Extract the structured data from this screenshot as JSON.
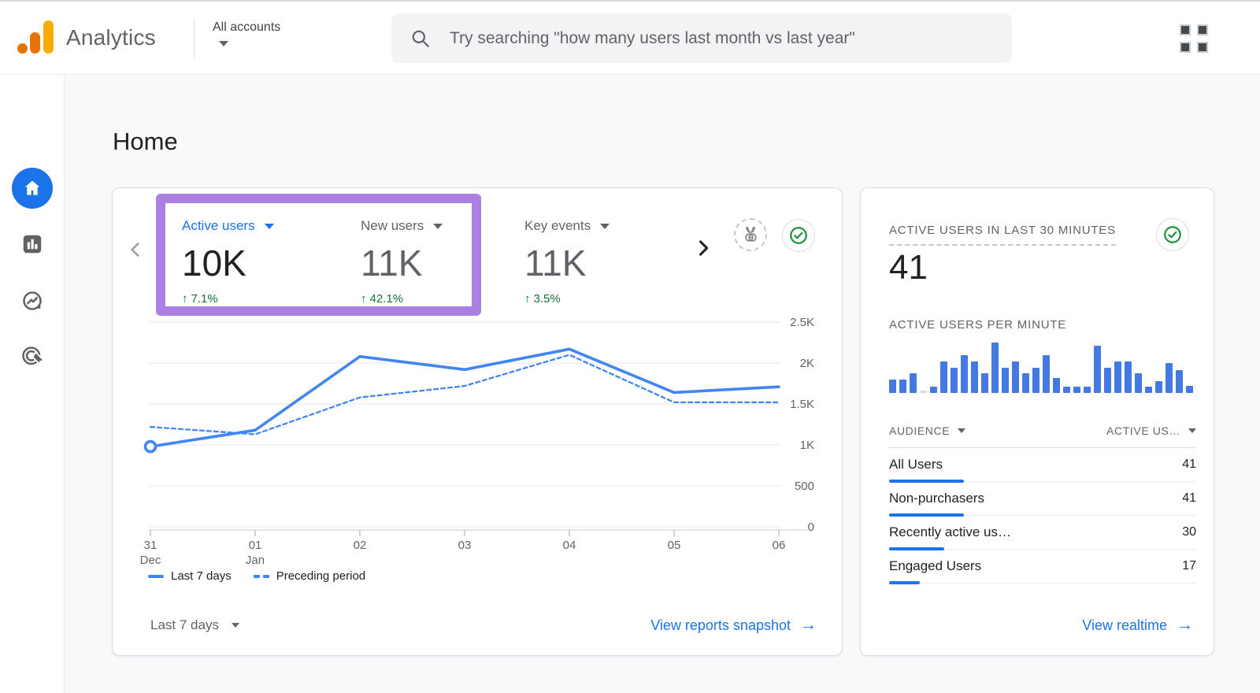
{
  "colors": {
    "accent_blue": "#1a73e8",
    "chart_blue": "#4285f4",
    "bar_blue": "#4479e4",
    "positive_green": "#137333",
    "check_green": "#1e8e3e",
    "annotation_purple": "#aa80e2",
    "muted_gray": "#5f6368",
    "logo_amber": "#f9ab00",
    "logo_orange": "#e37400"
  },
  "icons": {
    "up_arrow": "↑",
    "forward_arrow": "→"
  },
  "topbar": {
    "brand": "Analytics",
    "account_label": "All accounts",
    "search_placeholder": "Try searching \"how many users last month vs last year\""
  },
  "sidebar": {
    "items": [
      {
        "name": "home",
        "active": true
      },
      {
        "name": "reports",
        "active": false
      },
      {
        "name": "explore",
        "active": false
      },
      {
        "name": "advertising",
        "active": false
      }
    ]
  },
  "page": {
    "title": "Home"
  },
  "overview_card": {
    "metrics": [
      {
        "label": "Active users",
        "value": "10K",
        "change": "7.1%",
        "selected": true
      },
      {
        "label": "New users",
        "value": "11K",
        "change": "42.1%",
        "selected": false
      },
      {
        "label": "Key events",
        "value": "11K",
        "change": "3.5%",
        "selected": false
      }
    ],
    "legend": [
      {
        "label": "Last 7 days",
        "style": "solid"
      },
      {
        "label": "Preceding period",
        "style": "dashed"
      }
    ],
    "date_range": "Last 7 days",
    "snapshot_link": "View reports snapshot"
  },
  "realtime_card": {
    "title": "ACTIVE USERS IN LAST 30 MINUTES",
    "value": "41",
    "subtitle": "ACTIVE USERS PER MINUTE",
    "table": {
      "headers": [
        "AUDIENCE",
        "ACTIVE US…"
      ],
      "rows": [
        [
          "All Users",
          41
        ],
        [
          "Non-purchasers",
          41
        ],
        [
          "Recently active us…",
          30
        ],
        [
          "Engaged Users",
          17
        ]
      ],
      "max": 41
    },
    "realtime_link": "View realtime"
  },
  "chart_data": [
    {
      "type": "line",
      "title": "",
      "x": [
        [
          "31",
          "Dec"
        ],
        [
          "01",
          "Jan"
        ],
        [
          "02"
        ],
        [
          "03"
        ],
        [
          "04"
        ],
        [
          "05"
        ],
        [
          "06"
        ]
      ],
      "series": [
        {
          "name": "Last 7 days",
          "style": "solid",
          "values_k": [
            0.98,
            1.18,
            2.08,
            1.92,
            2.17,
            1.64,
            1.71
          ]
        },
        {
          "name": "Preceding period",
          "style": "dashed",
          "values_k": [
            1.22,
            1.13,
            1.58,
            1.72,
            2.1,
            1.52,
            1.52
          ]
        }
      ],
      "ylim": [
        0,
        2.5
      ],
      "yticks": [
        "2.5K",
        "2K",
        "1.5K",
        "1K",
        "500",
        "0"
      ],
      "grid": true,
      "legend_position": "bottom",
      "marker_on_first_point": true
    },
    {
      "type": "bar",
      "title": "ACTIVE USERS PER MINUTE",
      "values_pct": [
        26,
        26,
        39,
        4,
        12,
        62,
        50,
        75,
        62,
        39,
        100,
        50,
        62,
        39,
        50,
        75,
        30,
        12,
        12,
        12,
        93,
        50,
        62,
        62,
        39,
        12,
        24,
        60,
        46,
        14
      ],
      "muted_index": 3,
      "ylabel": "",
      "xlabel": ""
    }
  ]
}
